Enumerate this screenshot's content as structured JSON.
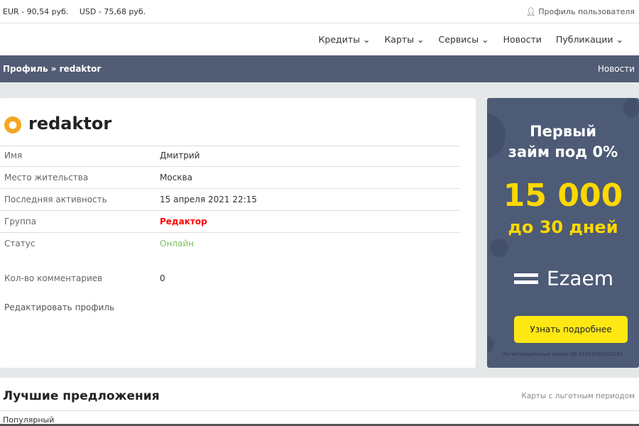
{
  "topbar": {
    "rates": [
      "EUR - 90,54 руб.",
      "USD - 75,68 руб."
    ],
    "profile": "Профиль пользователя"
  },
  "nav": {
    "items": [
      "Кредиты",
      "Карты",
      "Сервисы",
      "Новости",
      "Публикации"
    ]
  },
  "breadcrumb": {
    "current": "Профиль » redaktor",
    "right": "Новости"
  },
  "profile": {
    "username": "redaktor",
    "rows": [
      {
        "label": "Имя",
        "value": "Дмитрий"
      },
      {
        "label": "Место жительства",
        "value": "Москва"
      },
      {
        "label": "Последняя активность",
        "value": "15 апреля 2021 22:15"
      },
      {
        "label": "Группа",
        "value": "Редактор"
      },
      {
        "label": "Статус",
        "value": "Онлайн"
      },
      {
        "label": "Кол-во комментариев",
        "value": "0"
      }
    ],
    "edit_link": "Редактировать профиль"
  },
  "ad": {
    "line1": "Первый",
    "line2": "займ под 0%",
    "amount": "15 000",
    "term": "до 30 дней",
    "brand": "Ezaem",
    "button": "Узнать подробнее",
    "reg": "Регистрационный номер ЦБ 01303045003161"
  },
  "best": {
    "title": "Лучшие предложения",
    "link": "Карты с льготным периодом",
    "sub": "Популярный"
  },
  "colors": {
    "group": "#ff0000",
    "online": "#7cbf5b",
    "accent": "#ffd800"
  }
}
